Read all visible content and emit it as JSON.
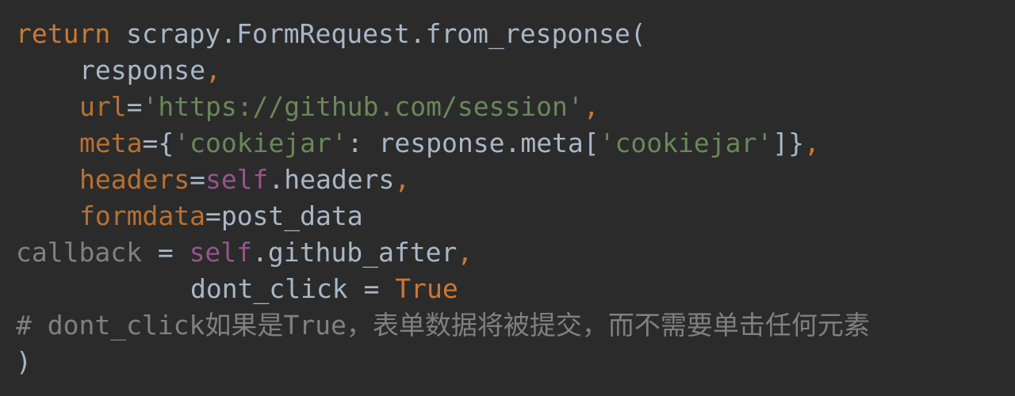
{
  "code": {
    "line1": {
      "keyword": "return",
      "call": " scrapy.FormRequest.from_response("
    },
    "line2": {
      "arg": "response",
      "comma": ","
    },
    "line3": {
      "name": "url",
      "eq": "=",
      "value": "'https://github.com/session'",
      "comma": ","
    },
    "line4": {
      "name": "meta",
      "open": "={",
      "key": "'cookiejar'",
      "mid": ": response.meta[",
      "key2": "'cookiejar'",
      "close": "]}",
      "comma": ","
    },
    "line5": {
      "name": "headers",
      "eq": "=",
      "self": "self",
      "attr": ".headers",
      "comma": ","
    },
    "line6": {
      "name": "formdata",
      "rest": "=post_data"
    },
    "line7": {
      "name": "callback",
      "eq": " = ",
      "self": "self",
      "attr": ".github_after",
      "comma": ","
    },
    "line8": {
      "name": "dont_click",
      "eq": " = ",
      "value": "True"
    },
    "line9": {
      "comment": "# dont_click如果是True，表单数据将被提交，而不需要单击任何元素"
    },
    "line10": {
      "close": ")"
    }
  },
  "colors": {
    "background": "#2b2b2b",
    "keyword": "#cc7832",
    "default": "#a9b7c6",
    "string": "#6a8759",
    "self": "#94558d",
    "comment": "#808080"
  }
}
